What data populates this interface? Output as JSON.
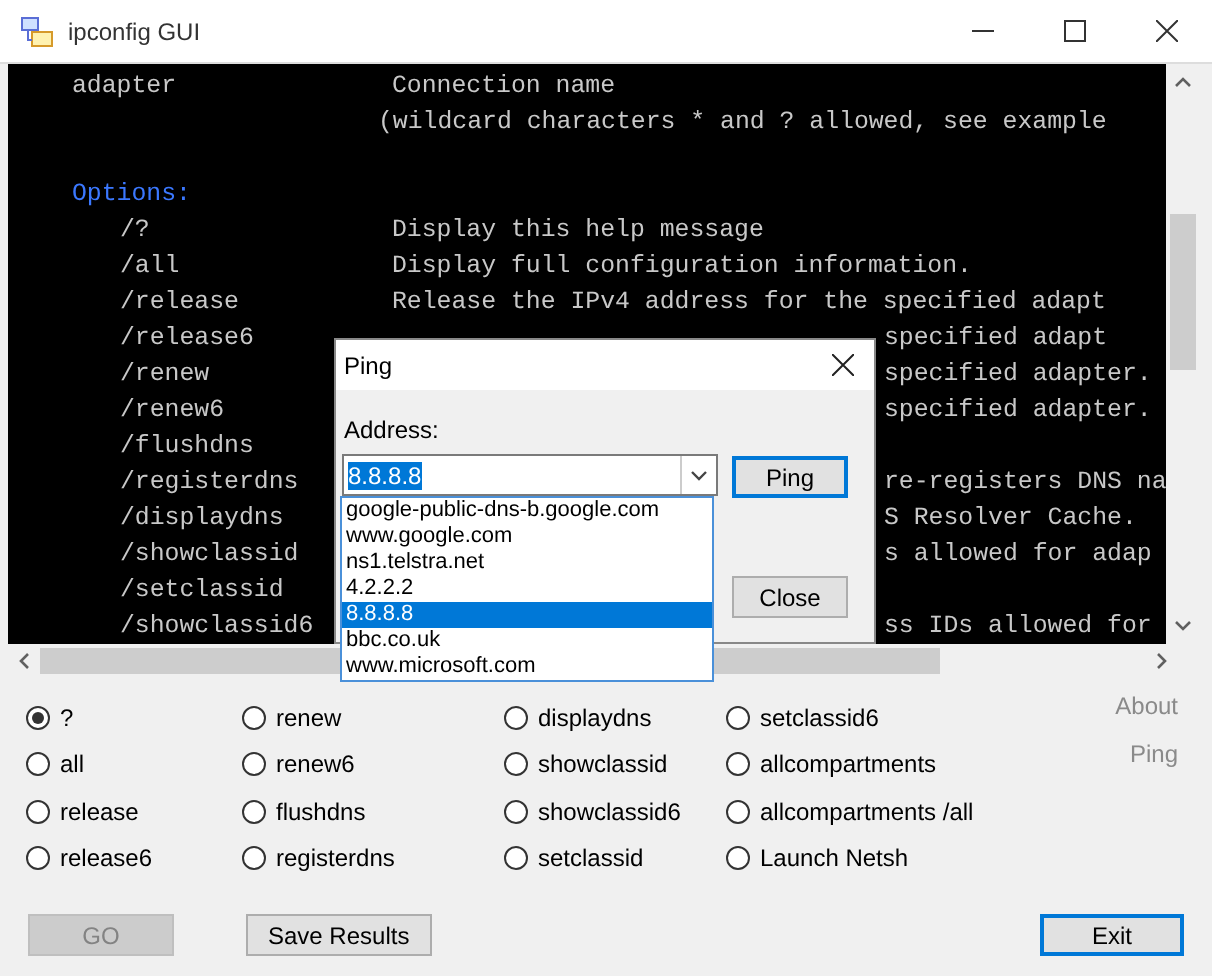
{
  "window": {
    "title": "ipconfig GUI"
  },
  "console": {
    "lines": [
      {
        "kind": "entry",
        "col1": "adapter",
        "col2": "Connection name"
      },
      {
        "kind": "continuation",
        "col2": "(wildcard characters * and ? allowed, see example"
      },
      {
        "kind": "blank"
      },
      {
        "kind": "heading",
        "col1": "Options:"
      },
      {
        "kind": "option",
        "col1": "/?",
        "col2": "Display this help message"
      },
      {
        "kind": "option",
        "col1": "/all",
        "col2": "Display full configuration information."
      },
      {
        "kind": "option",
        "col1": "/release",
        "col2": "Release the IPv4 address for the specified adapt"
      },
      {
        "kind": "partial",
        "col1": "/release6",
        "col2": "specified adapt"
      },
      {
        "kind": "partial",
        "col1": "/renew",
        "col2": "specified adapter."
      },
      {
        "kind": "partial",
        "col1": "/renew6",
        "col2": "specified adapter."
      },
      {
        "kind": "option",
        "col1": "/flushdns"
      },
      {
        "kind": "partial",
        "col1": "/registerdns",
        "col2": "re-registers DNS na"
      },
      {
        "kind": "partial",
        "col1": "/displaydns",
        "col2": "S Resolver Cache."
      },
      {
        "kind": "partial",
        "col1": "/showclassid",
        "col2": "s allowed for adap"
      },
      {
        "kind": "option",
        "col1": "/setclassid"
      },
      {
        "kind": "partial",
        "col1": "/showclassid6",
        "col2": "ss IDs allowed for"
      }
    ]
  },
  "ping_dialog": {
    "title": "Ping",
    "address_label": "Address:",
    "combo": {
      "value": "8.8.8.8",
      "options": [
        {
          "label": "google-public-dns-b.google.com",
          "selected": false
        },
        {
          "label": "www.google.com",
          "selected": false
        },
        {
          "label": "ns1.telstra.net",
          "selected": false
        },
        {
          "label": "4.2.2.2",
          "selected": false
        },
        {
          "label": "8.8.8.8",
          "selected": true
        },
        {
          "label": "bbc.co.uk",
          "selected": false
        },
        {
          "label": "www.microsoft.com",
          "selected": false
        }
      ]
    },
    "buttons": [
      {
        "label": "Ping",
        "focused": true
      },
      {
        "label": "Close",
        "focused": false
      }
    ]
  },
  "options": [
    {
      "label": "?",
      "selected": true
    },
    {
      "label": "all",
      "selected": false
    },
    {
      "label": "release",
      "selected": false
    },
    {
      "label": "release6",
      "selected": false
    },
    {
      "label": "renew",
      "selected": false
    },
    {
      "label": "renew6",
      "selected": false
    },
    {
      "label": "flushdns",
      "selected": false
    },
    {
      "label": "registerdns",
      "selected": false
    },
    {
      "label": "displaydns",
      "selected": false
    },
    {
      "label": "showclassid",
      "selected": false
    },
    {
      "label": "showclassid6",
      "selected": false
    },
    {
      "label": "setclassid",
      "selected": false
    },
    {
      "label": "setclassid6",
      "selected": false
    },
    {
      "label": "allcompartments",
      "selected": false
    },
    {
      "label": "allcompartments /all",
      "selected": false
    },
    {
      "label": "Launch Netsh",
      "selected": false
    }
  ],
  "links": [
    "About",
    "Ping"
  ],
  "buttons": [
    {
      "label": "GO",
      "disabled": true,
      "focused": false
    },
    {
      "label": "Save Results",
      "disabled": false,
      "focused": false
    },
    {
      "label": "Exit",
      "disabled": false,
      "focused": true
    }
  ]
}
